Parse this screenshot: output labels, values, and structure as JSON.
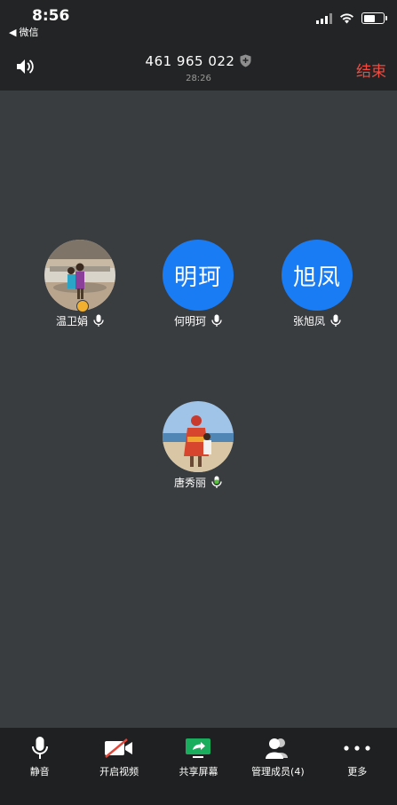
{
  "status_bar": {
    "time": "8:56",
    "back_app": "微信"
  },
  "header": {
    "meeting_id": "461 965 022",
    "duration": "28:26",
    "end_label": "结束"
  },
  "participants": [
    {
      "name": "温卫娟",
      "avatar": "photo",
      "host": true
    },
    {
      "name": "何明珂",
      "avatar_text": "明珂"
    },
    {
      "name": "张旭凤",
      "avatar_text": "旭凤"
    },
    {
      "name": "唐秀丽",
      "avatar": "photo",
      "speaking": true
    }
  ],
  "toolbar": {
    "mute": "静音",
    "video": "开启视频",
    "share": "共享屏幕",
    "members": "管理成员(4)",
    "more": "更多"
  },
  "colors": {
    "accent_blue": "#1a7cf5",
    "end_red": "#f04b41",
    "share_green": "#1aad5e",
    "speaking_green": "#56c23c"
  }
}
